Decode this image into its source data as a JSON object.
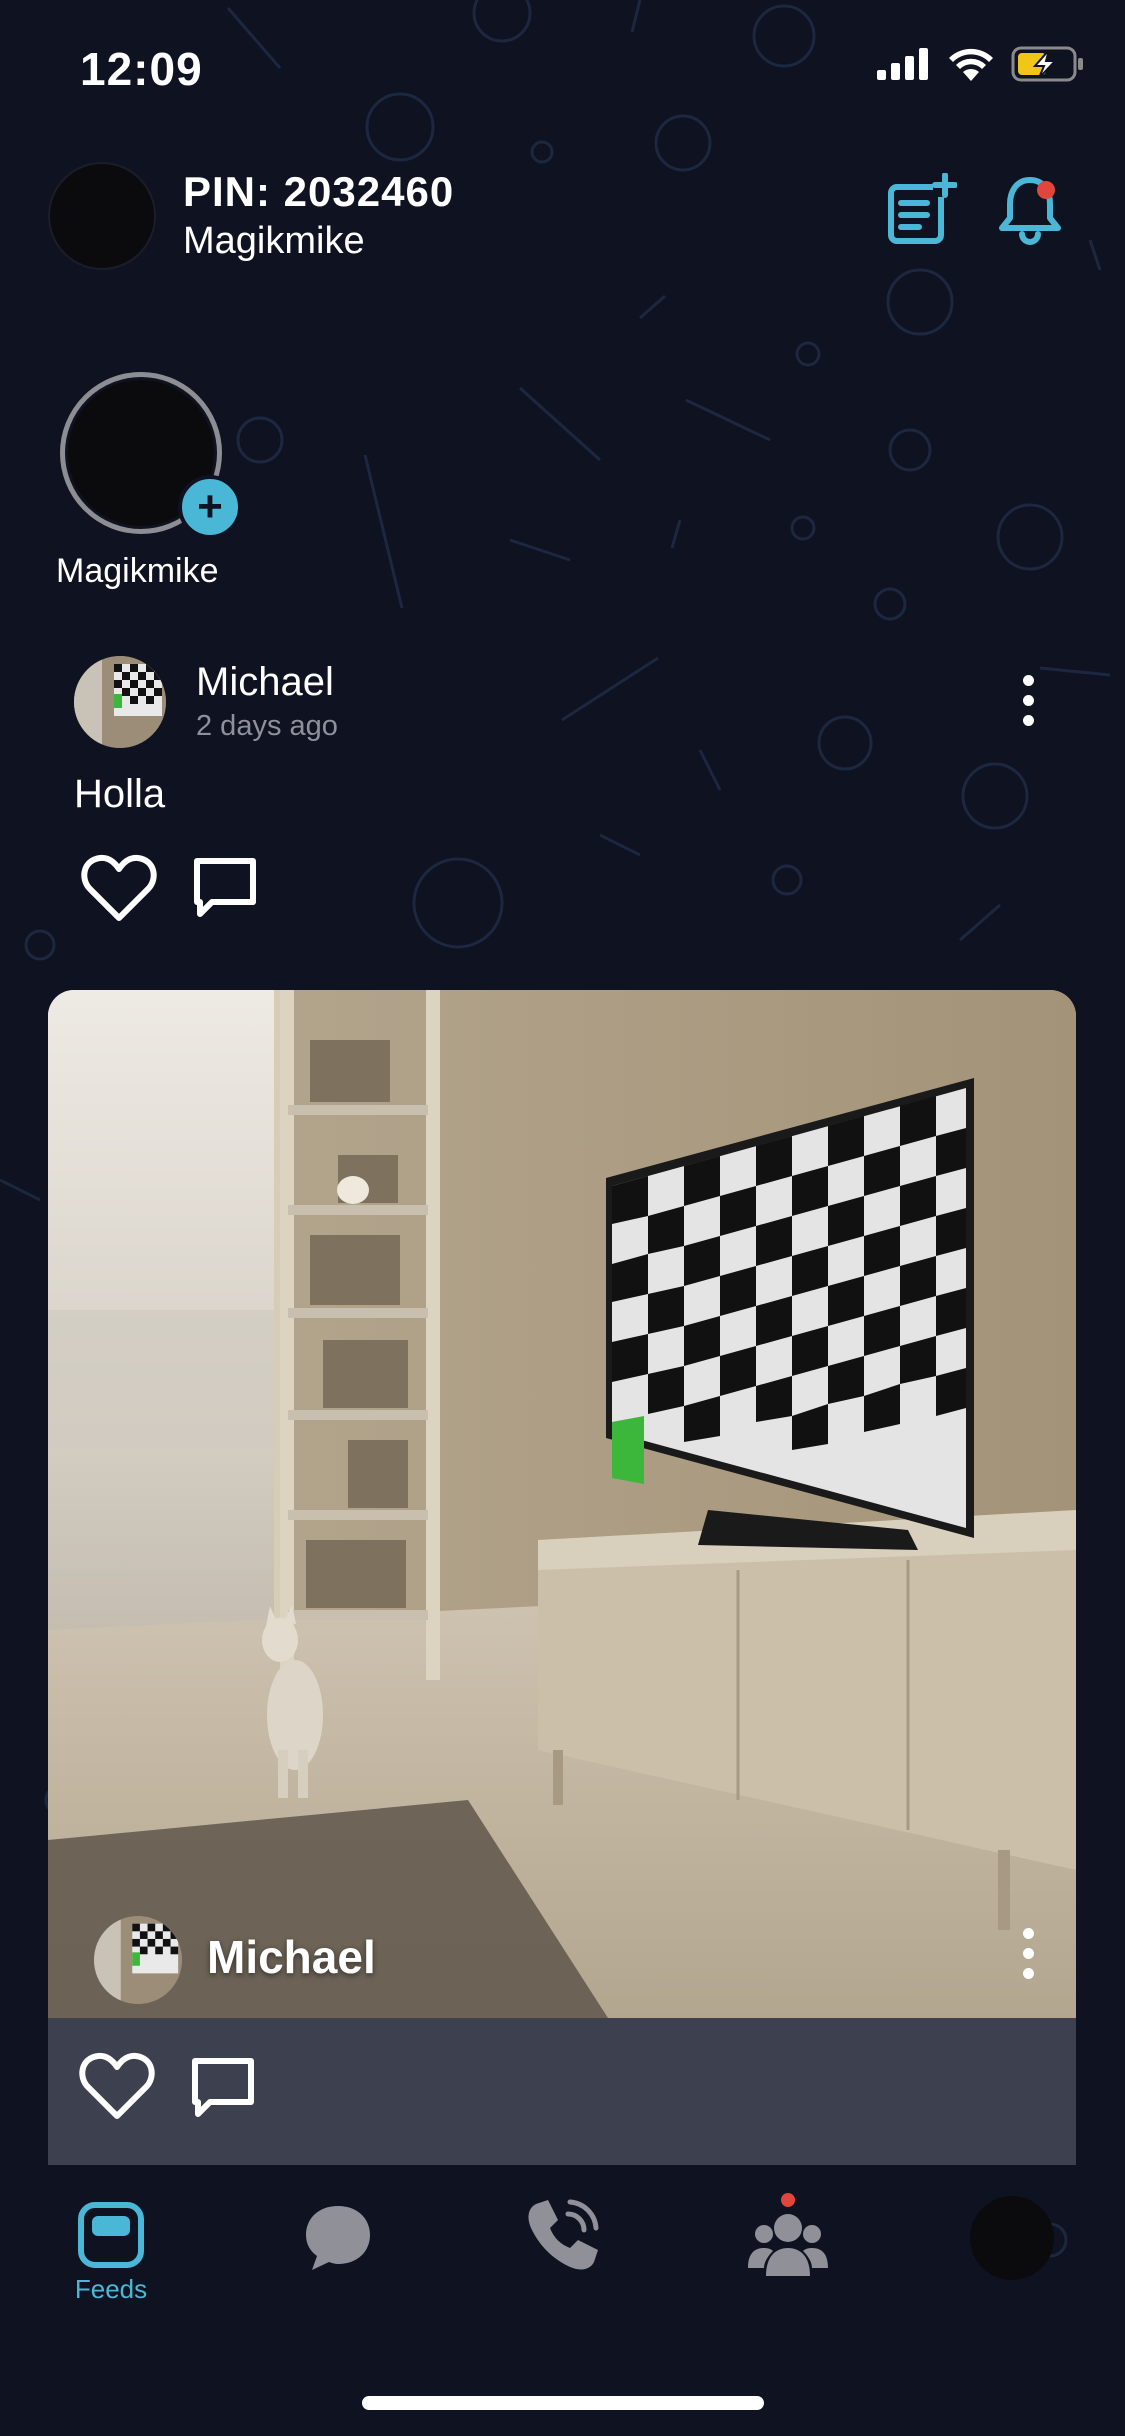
{
  "status_bar": {
    "time": "12:09",
    "icons": [
      "signal-icon",
      "wifi-icon",
      "battery-charging-icon"
    ]
  },
  "header": {
    "pin_label": "PIN: 2032460",
    "username": "Magikmike",
    "actions": [
      "new-post-icon",
      "notification-bell-icon"
    ]
  },
  "stories": [
    {
      "label": "Magikmike",
      "add_icon": "plus-icon"
    }
  ],
  "posts": [
    {
      "author": "Michael",
      "time": "2 days ago",
      "text": "Holla",
      "actions": [
        "heart-icon",
        "comment-icon"
      ]
    },
    {
      "author": "Michael",
      "media": "living room with TV showing checkerboard and cat",
      "actions": [
        "heart-icon",
        "comment-icon"
      ]
    }
  ],
  "tab_bar": {
    "tabs": [
      {
        "icon": "feeds-icon",
        "label": "Feeds",
        "active": true
      },
      {
        "icon": "chat-bubble-icon",
        "label": ""
      },
      {
        "icon": "phone-icon",
        "label": ""
      },
      {
        "icon": "contacts-icon",
        "label": "",
        "badge": true
      },
      {
        "icon": "profile-avatar",
        "label": ""
      }
    ]
  },
  "colors": {
    "background": "#0f1221",
    "accent": "#4ab7d6",
    "badge": "#e0463c",
    "card_bar": "#3d404f"
  }
}
